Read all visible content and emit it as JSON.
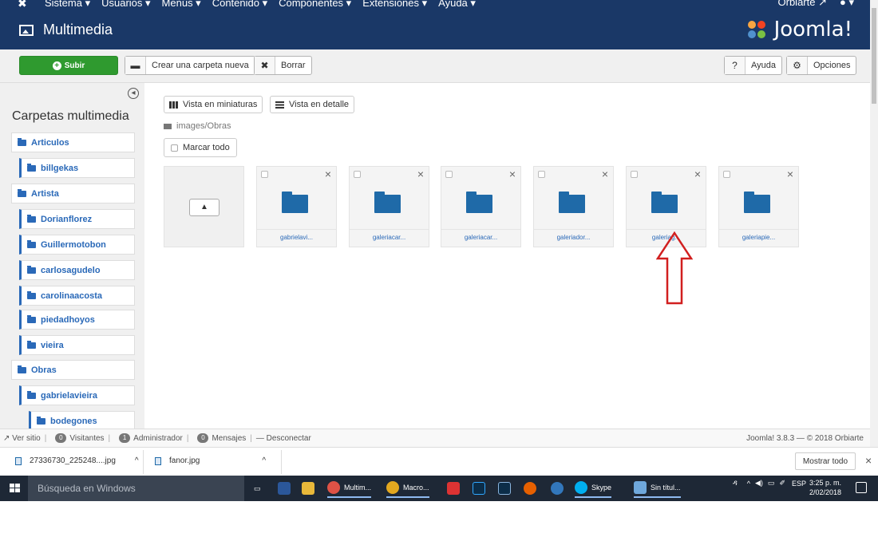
{
  "topnav": {
    "menus": [
      "Sistema ▾",
      "Usuarios ▾",
      "Menús ▾",
      "Contenido ▾",
      "Componentes ▾",
      "Extensiones ▾",
      "Ayuda ▾"
    ],
    "user": "Orbiarte",
    "user_icon": "external-link-icon",
    "account_icon": "user-icon"
  },
  "header": {
    "title": "Multimedia",
    "logo_text": "Joomla!"
  },
  "toolbar": {
    "upload_label": "Subir",
    "new_folder_label": "Crear una carpeta nueva",
    "delete_label": "Borrar",
    "help_label": "Ayuda",
    "options_label": "Opciones"
  },
  "sidebar": {
    "heading": "Carpetas multimedia",
    "tree": [
      {
        "label": "Articulos",
        "level": 0
      },
      {
        "label": "billgekas",
        "level": 1
      },
      {
        "label": "Artista",
        "level": 0
      },
      {
        "label": "Dorianflorez",
        "level": 1
      },
      {
        "label": "Guillermotobon",
        "level": 1
      },
      {
        "label": "carlosagudelo",
        "level": 1
      },
      {
        "label": "carolinaacosta",
        "level": 1
      },
      {
        "label": "piedadhoyos",
        "level": 1
      },
      {
        "label": "vieira",
        "level": 1
      },
      {
        "label": "Obras",
        "level": 0
      },
      {
        "label": "gabrielavieira",
        "level": 1
      },
      {
        "label": "bodegones",
        "level": 2
      }
    ]
  },
  "main": {
    "view_thumbs_label": "Vista en miniaturas",
    "view_detail_label": "Vista en detalle",
    "path": "images/Obras",
    "select_all_label": "Marcar todo",
    "folders": [
      "gabrielavi...",
      "galeriacar...",
      "galeriacar...",
      "galeriador...",
      "galeriag...",
      "galeriapie..."
    ]
  },
  "statusbar": {
    "view_site": "Ver sitio",
    "visitors_count": "0",
    "visitors_label": "Visitantes",
    "admins_count": "1",
    "admins_label": "Administrador",
    "messages_count": "0",
    "messages_label": "Mensajes",
    "logout_label": "Desconectar",
    "version": "Joomla! 3.8.3 — © 2018 Orbiarte"
  },
  "downloads": {
    "items": [
      "27336730_225248....jpg",
      "fanor.jpg"
    ],
    "show_all_label": "Mostrar todo"
  },
  "taskbar": {
    "search_placeholder": "Búsqueda en Windows",
    "apps": [
      "Multim...",
      "Macro...",
      "Skype",
      "Sin títul..."
    ],
    "lang": "ESP",
    "time": "3:25 p. m.",
    "date": "2/02/2018"
  },
  "colors": {
    "navbar": "#1a3867",
    "upload_green": "#2f9a2f",
    "folder_blue": "#1f6aa8",
    "annotation_red": "#d11f1f"
  }
}
